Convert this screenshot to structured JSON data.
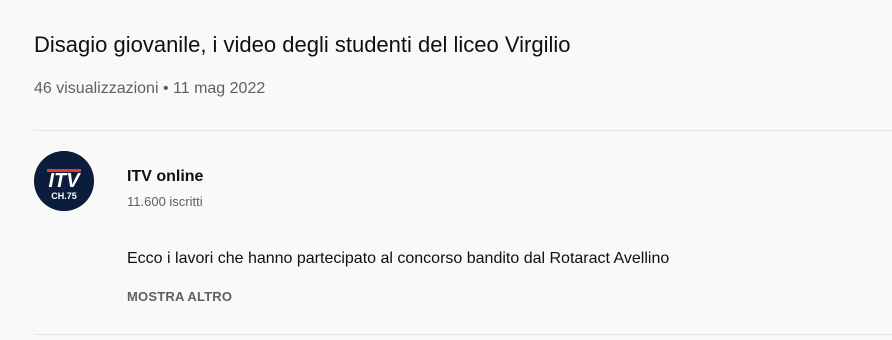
{
  "video": {
    "title": "Disagio giovanile, i video degli studenti del liceo Virgilio",
    "views": "46 visualizzazioni",
    "separator": " • ",
    "date": "11 mag 2022"
  },
  "channel": {
    "name": "ITV online",
    "subscribers": "11.600 iscritti",
    "logo_text_top": "ITV",
    "logo_text_bottom": "CH.75",
    "logo_colors": {
      "background": "#0c1c3c",
      "text": "#ffffff",
      "accent": "#e53935"
    }
  },
  "description": {
    "text": "Ecco i lavori che hanno partecipato al concorso bandito dal Rotaract Avellino",
    "show_more_label": "MOSTRA ALTRO"
  }
}
